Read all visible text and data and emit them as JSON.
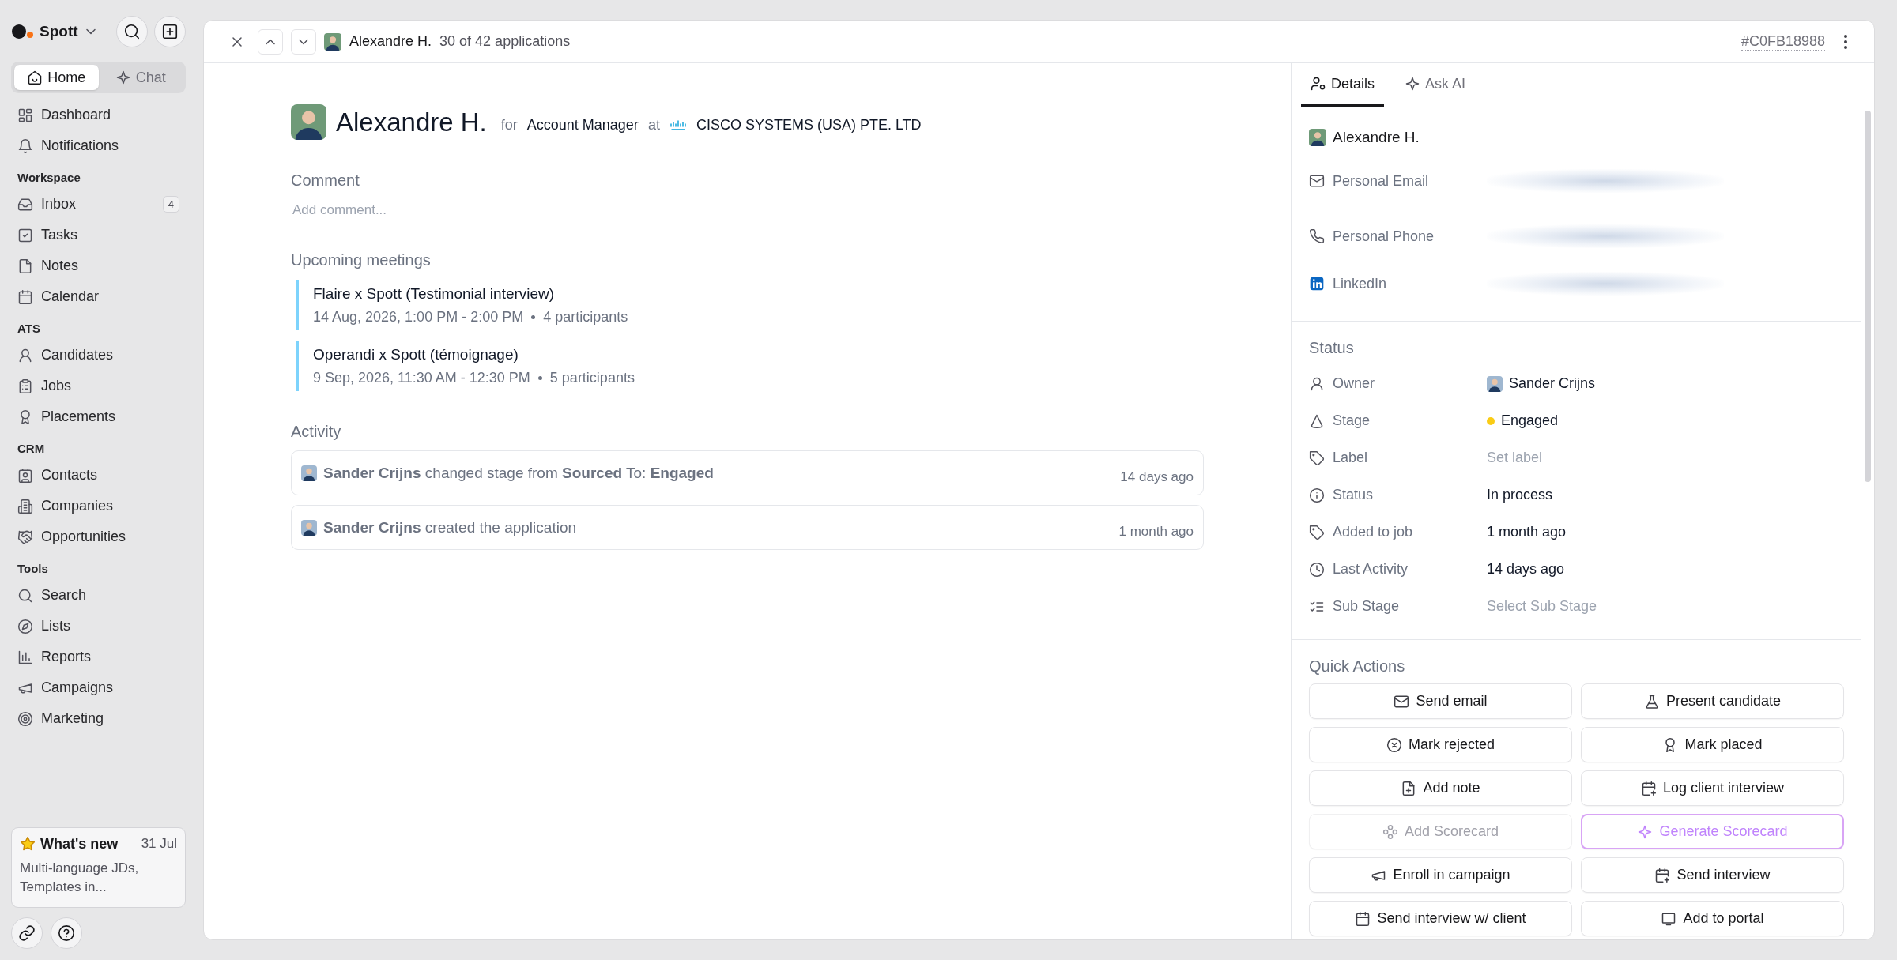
{
  "sidebar": {
    "brand": "Spott",
    "modes": [
      {
        "label": "Home",
        "selected": true
      },
      {
        "label": "Chat",
        "selected": false
      }
    ],
    "items": [
      {
        "label": "Dashboard"
      },
      {
        "label": "Notifications"
      }
    ],
    "sections": [
      {
        "title": "Workspace",
        "items": [
          {
            "label": "Inbox",
            "badge": "4"
          },
          {
            "label": "Tasks"
          },
          {
            "label": "Notes"
          },
          {
            "label": "Calendar"
          }
        ]
      },
      {
        "title": "ATS",
        "items": [
          {
            "label": "Candidates"
          },
          {
            "label": "Jobs"
          },
          {
            "label": "Placements"
          }
        ]
      },
      {
        "title": "CRM",
        "items": [
          {
            "label": "Contacts"
          },
          {
            "label": "Companies"
          },
          {
            "label": "Opportunities"
          }
        ]
      },
      {
        "title": "Tools",
        "items": [
          {
            "label": "Search"
          },
          {
            "label": "Lists"
          },
          {
            "label": "Reports"
          },
          {
            "label": "Campaigns"
          },
          {
            "label": "Marketing"
          }
        ]
      }
    ],
    "whats_new": {
      "title": "What's new",
      "date": "31 Jul",
      "text": "Multi-language JDs, Templates in..."
    }
  },
  "header": {
    "candidate": "Alexandre H.",
    "position": "30 of 42 applications",
    "id": "#C0FB18988"
  },
  "application": {
    "name": "Alexandre H.",
    "for": "for",
    "role": "Account Manager",
    "at": "at",
    "company": "CISCO SYSTEMS (USA) PTE. LTD",
    "comment": {
      "label": "Comment",
      "placeholder": "Add comment..."
    },
    "meetings": {
      "title": "Upcoming meetings",
      "items": [
        {
          "title": "Flaire x Spott (Testimonial interview)",
          "time": "14 Aug, 2026, 1:00 PM - 2:00 PM",
          "participants": "4 participants"
        },
        {
          "title": "Operandi x Spott (témoignage)",
          "time": "9 Sep, 2026, 11:30 AM - 12:30 PM",
          "participants": "5 participants"
        }
      ]
    },
    "activity": {
      "title": "Activity",
      "items": [
        {
          "text": "**Sander Crijns** changed stage from **Sourced** To: **Engaged**",
          "time": "14 days ago"
        },
        {
          "text": "**Sander Crijns** created the application",
          "time": "1 month ago"
        }
      ]
    }
  },
  "details": {
    "tabs": [
      {
        "label": "Details",
        "selected": true
      },
      {
        "label": "Ask AI",
        "selected": false
      }
    ],
    "contact": {
      "name": "Alexandre H.",
      "fields": [
        {
          "label": "Personal Email",
          "redacted": true
        },
        {
          "label": "Personal Phone",
          "redacted": true
        },
        {
          "label": "LinkedIn",
          "redacted": true
        }
      ]
    },
    "status": {
      "title": "Status",
      "rows": [
        {
          "label": "Owner",
          "kind": "person",
          "value": "Sander Crijns"
        },
        {
          "label": "Stage",
          "kind": "stage",
          "value": "Engaged",
          "color": "#facc15"
        },
        {
          "label": "Label",
          "kind": "select",
          "placeholder": "Set label"
        },
        {
          "label": "Status",
          "kind": "text",
          "value": "In process"
        },
        {
          "label": "Added to job",
          "kind": "text",
          "value": "1 month ago"
        },
        {
          "label": "Last Activity",
          "kind": "text",
          "value": "14 days ago"
        },
        {
          "label": "Sub Stage",
          "kind": "select",
          "placeholder": "Select Sub Stage"
        }
      ]
    },
    "quick_actions": {
      "title": "Quick Actions",
      "buttons": [
        {
          "label": "Send email",
          "kind": "normal",
          "disabled": false
        },
        {
          "label": "Present candidate",
          "kind": "normal",
          "disabled": false
        },
        {
          "label": "Mark rejected",
          "kind": "normal",
          "disabled": false
        },
        {
          "label": "Mark placed",
          "kind": "normal",
          "disabled": false
        },
        {
          "label": "Add note",
          "kind": "normal",
          "disabled": false
        },
        {
          "label": "Log client interview",
          "kind": "normal",
          "disabled": false
        },
        {
          "label": "Add Scorecard",
          "kind": "normal",
          "disabled": true
        },
        {
          "label": "Generate Scorecard",
          "kind": "ai",
          "disabled": false
        },
        {
          "label": "Enroll in campaign",
          "kind": "normal",
          "disabled": false
        },
        {
          "label": "Send interview",
          "kind": "normal",
          "disabled": false
        },
        {
          "label": "Send interview w/ client",
          "kind": "normal",
          "disabled": false
        },
        {
          "label": "Add to portal",
          "kind": "normal",
          "disabled": false
        }
      ]
    }
  }
}
